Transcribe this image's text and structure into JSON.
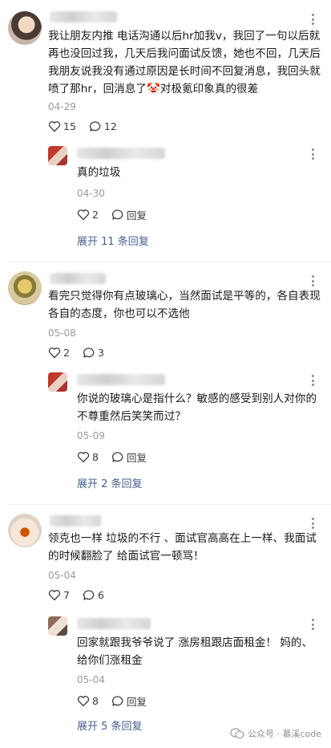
{
  "comments": [
    {
      "text": "我让朋友内推 电话沟通以后hr加我v，我回了一句以后就再也没回过我，几天后我问面试反馈，她也不回，几天后我朋友说我没有通过原因是长时间不回复消息，我回头就喷了那hr，回消息了🤡对极氪印象真的很差",
      "date": "04-29",
      "likes": "15",
      "comments": "12",
      "reply": {
        "text": "真的垃圾",
        "date": "04-30",
        "likes": "2",
        "reply_label": "回复"
      },
      "expand": "展开 11 条回复"
    },
    {
      "text": "看完只觉得你有点玻璃心，当然面试是平等的，各自表现各自的态度，你也可以不选他",
      "date": "05-08",
      "likes": "2",
      "comments": "3",
      "reply": {
        "text": "你说的玻璃心是指什么？敏感的感受到别人对你的不尊重然后笑笑而过？",
        "date": "05-09",
        "likes": "8",
        "reply_label": "回复"
      },
      "expand": "展开 2 条回复"
    },
    {
      "text": "领克也一样 垃圾的不行 、面试官高高在上一样、我面试的时候翻脸了 给面试官一顿骂！",
      "date": "05-04",
      "likes": "7",
      "comments": "6",
      "reply": {
        "text": "回家就跟我爷爷说了 涨房租跟店面租金！ 妈的、给你们涨租金",
        "date": "05-04",
        "likes": "8",
        "reply_label": "回复"
      },
      "expand": "展开 5 条回复"
    }
  ],
  "watermark": {
    "text": "公众号 · 慕溪code"
  },
  "colors": {
    "link": "#46608f",
    "meta": "#9a9a9a",
    "text": "#1a1a1a"
  },
  "icons": {
    "like": "heart-outline-icon",
    "comment": "speech-bubble-icon",
    "more": "more-vertical-icon"
  }
}
